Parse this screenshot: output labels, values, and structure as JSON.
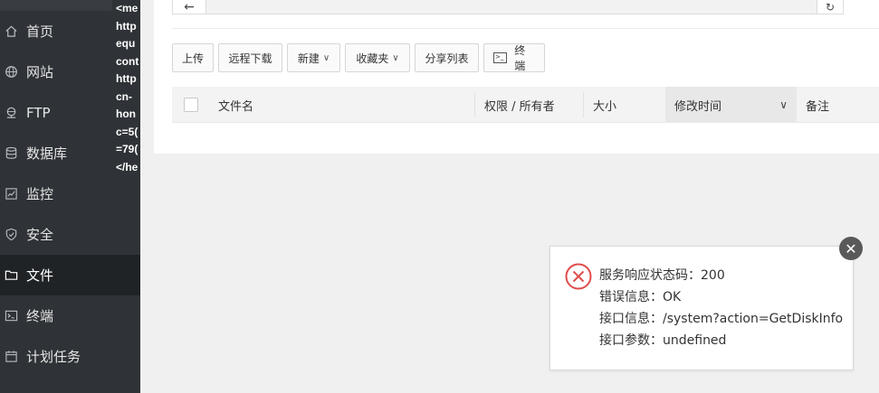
{
  "sidebar": {
    "items": [
      {
        "label": "首页",
        "icon": "home-icon"
      },
      {
        "label": "网站",
        "icon": "globe-icon"
      },
      {
        "label": "FTP",
        "icon": "ftp-icon"
      },
      {
        "label": "数据库",
        "icon": "database-icon"
      },
      {
        "label": "监控",
        "icon": "monitor-icon"
      },
      {
        "label": "安全",
        "icon": "shield-icon"
      },
      {
        "label": "文件",
        "icon": "folder-icon",
        "active": true
      },
      {
        "label": "终端",
        "icon": "terminal-icon"
      },
      {
        "label": "计划任务",
        "icon": "calendar-icon"
      }
    ]
  },
  "overlay_text": {
    "lines": [
      "<me",
      "http",
      "equ",
      "cont",
      "http",
      "cn-",
      "hon",
      "c=5(",
      "=79(",
      "</he"
    ]
  },
  "toolbar": {
    "upload": "上传",
    "remote_download": "远程下载",
    "new": "新建",
    "favorites": "收藏夹",
    "share_list": "分享列表",
    "terminal": "终端"
  },
  "table": {
    "headers": {
      "filename": "文件名",
      "permission": "权限 / 所有者",
      "size": "大小",
      "modified": "修改时间",
      "note": "备注"
    }
  },
  "error_popup": {
    "status_line": "服务响应状态码：200",
    "error_line": "错误信息：OK",
    "api_line": "接口信息：/system?action=GetDiskInfo",
    "params_line": "接口参数：undefined"
  },
  "colors": {
    "sidebar_bg": "#2f3337",
    "sidebar_active": "#202326",
    "error_red": "#e04b4b",
    "close_btn": "#595959"
  }
}
